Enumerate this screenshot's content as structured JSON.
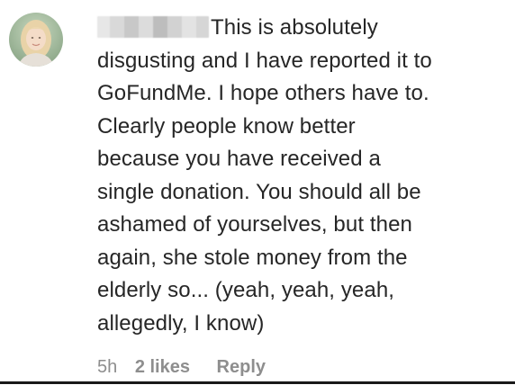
{
  "comment": {
    "username_redacted": true,
    "text_lines": [
      "This is absolutely",
      "disgusting and I have reported it to",
      "GoFundMe. I hope others have to.",
      "Clearly people know better",
      "because you have received a",
      "single donation. You should all be",
      "ashamed of yourselves, but then",
      "again, she stole money from the",
      "elderly so... (yeah, yeah, yeah,",
      "allegedly, I know)"
    ],
    "time": "5h",
    "likes": "2 likes",
    "reply_label": "Reply"
  },
  "icons": {
    "avatar": "user-avatar-photo"
  },
  "colors": {
    "text": "#262626",
    "meta": "#8e8e8e",
    "background": "#ffffff"
  }
}
